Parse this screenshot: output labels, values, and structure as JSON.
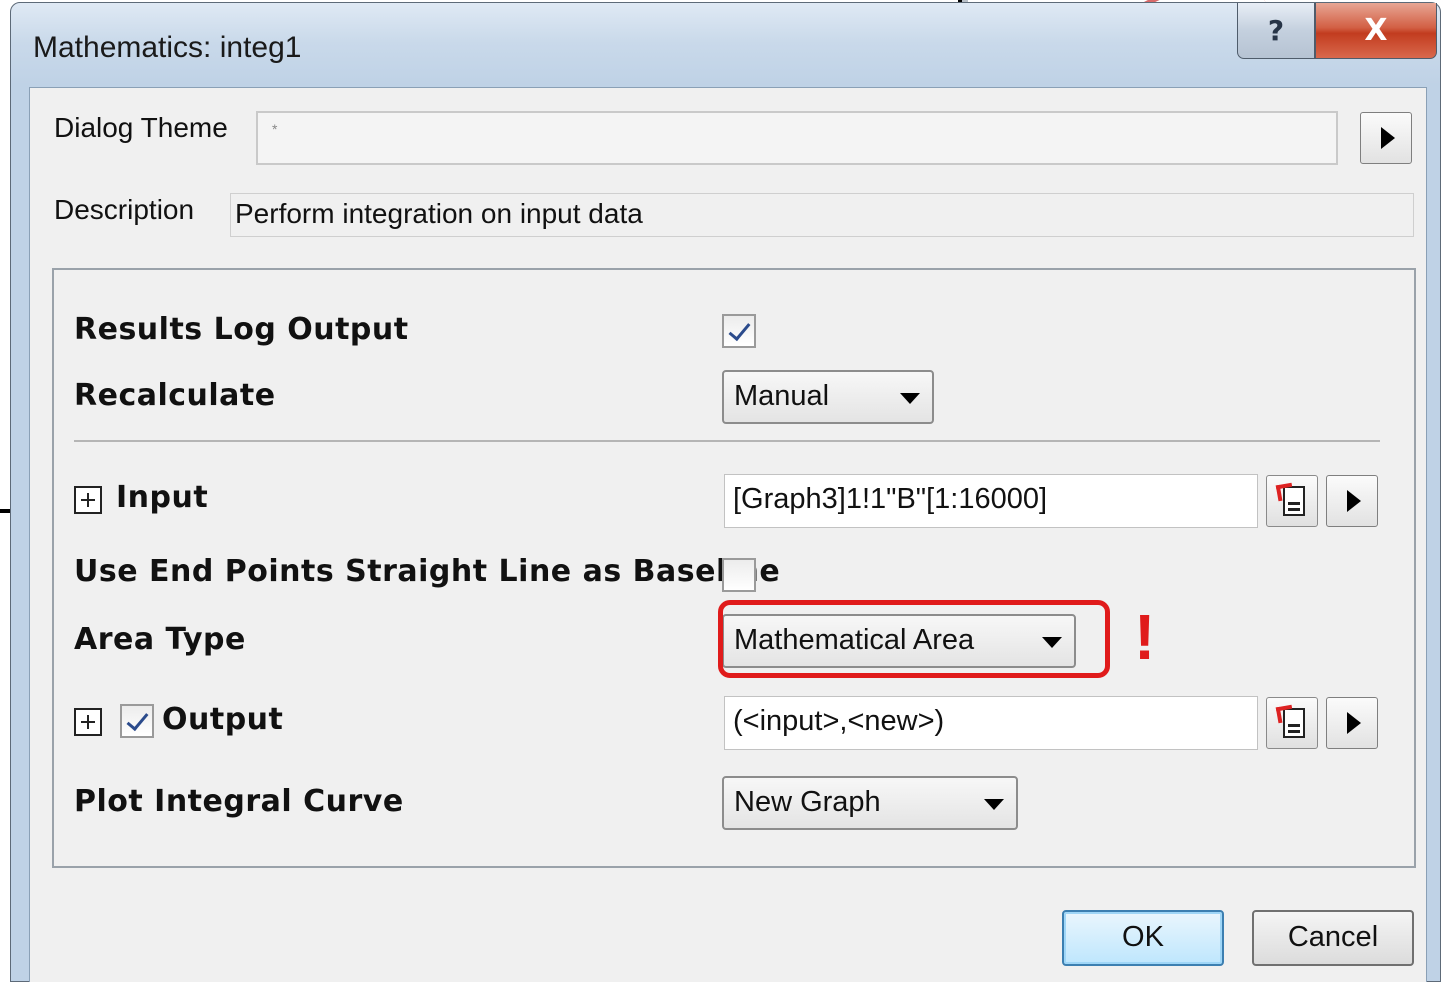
{
  "window": {
    "title": "Mathematics: integ1",
    "help_glyph": "?",
    "close_glyph": "X"
  },
  "header": {
    "dialog_theme_label": "Dialog Theme",
    "dialog_theme_value": "*",
    "description_label": "Description",
    "description_value": "Perform integration on input data"
  },
  "settings": {
    "results_log_output": {
      "label": "Results Log Output",
      "checked": true
    },
    "recalculate": {
      "label": "Recalculate",
      "value": "Manual"
    },
    "input": {
      "label": "Input",
      "value": "[Graph3]1!1\"B\"[1:16000]"
    },
    "use_end_points": {
      "label": "Use End Points Straight Line as Baseline",
      "checked": false
    },
    "area_type": {
      "label": "Area Type",
      "value": "Mathematical Area"
    },
    "output": {
      "label": "Output",
      "checked": true,
      "value": "(<input>,<new>)"
    },
    "plot_integral_curve": {
      "label": "Plot Integral Curve",
      "value": "New Graph"
    }
  },
  "annotation": {
    "mark": "!",
    "color": "#e01b1b"
  },
  "footer": {
    "ok_label": "OK",
    "cancel_label": "Cancel"
  }
}
